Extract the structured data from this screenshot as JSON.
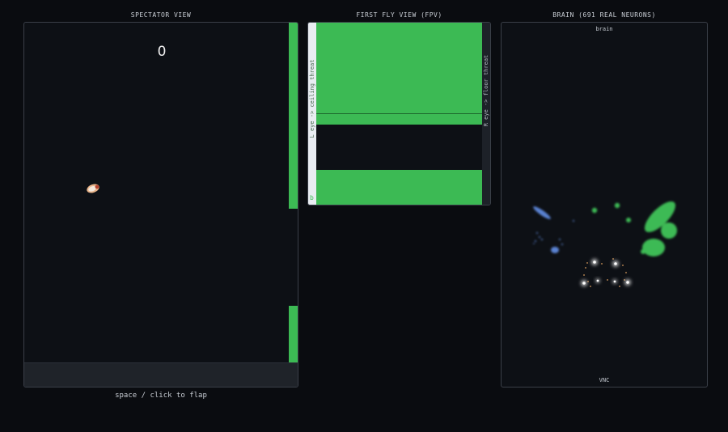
{
  "spectator": {
    "title": "SPECTATOR VIEW",
    "score": "0",
    "hint": "space / click to flap",
    "fly_icon": "fly-sprite"
  },
  "ffv": {
    "title": "FIRST FLY VIEW (FPV)",
    "left_eye_label": "L eye -> ceiling threat",
    "right_eye_label": "R eye -> floor threat",
    "marker": "b"
  },
  "brain": {
    "title": "BRAIN (691 REAL NEURONS)",
    "top_label": "brain",
    "bottom_label": "VNC"
  },
  "colors": {
    "background": "#0a0c10",
    "panel": "#0d1015",
    "pipe": "#3cba54",
    "neuron_green": "#3cba54",
    "neuron_blue": "#5a82d2",
    "neuron_white": "#ffffff"
  }
}
